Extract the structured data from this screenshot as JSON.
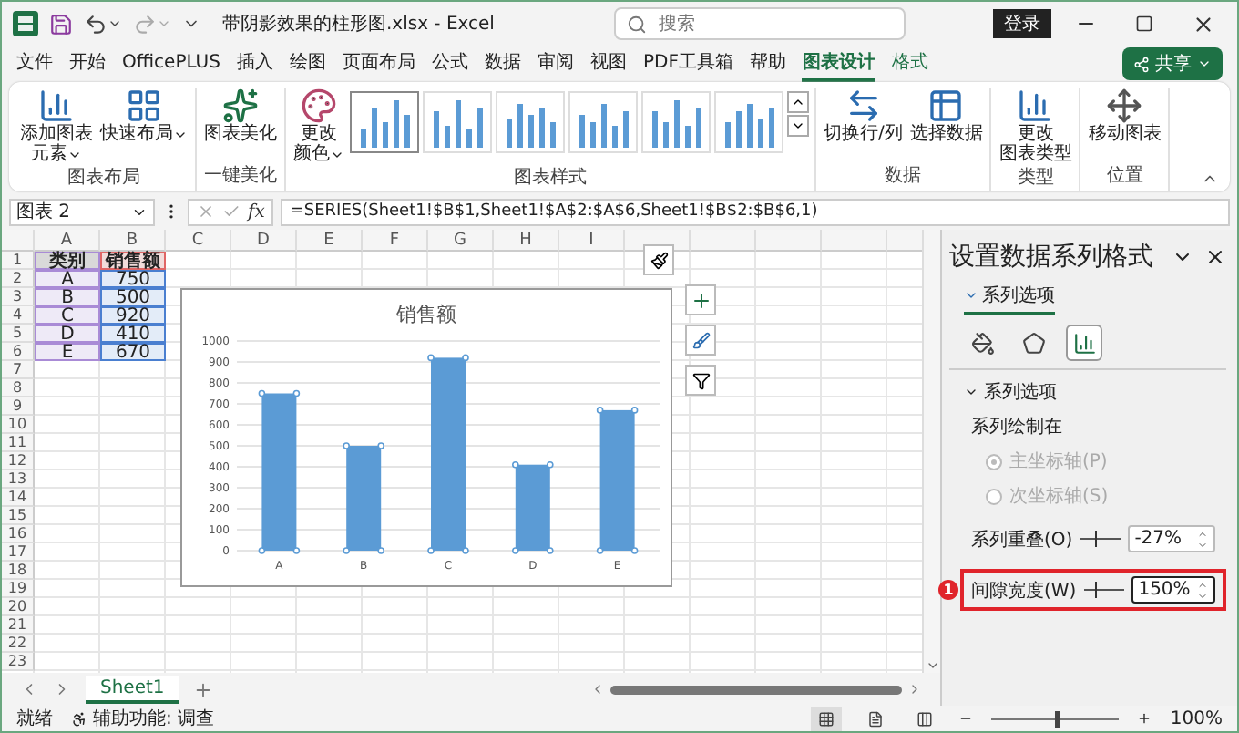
{
  "title_bar": {
    "file_title": "带阴影效果的柱形图.xlsx  -  Excel",
    "search": {
      "placeholder": "搜索"
    },
    "sign_in": "登录"
  },
  "menu_tabs": [
    {
      "label": "文件",
      "selected": false,
      "kind": "normal"
    },
    {
      "label": "开始",
      "selected": false,
      "kind": "normal"
    },
    {
      "label": "OfficePLUS",
      "selected": false,
      "kind": "normal"
    },
    {
      "label": "插入",
      "selected": false,
      "kind": "normal"
    },
    {
      "label": "绘图",
      "selected": false,
      "kind": "normal"
    },
    {
      "label": "页面布局",
      "selected": false,
      "kind": "normal"
    },
    {
      "label": "公式",
      "selected": false,
      "kind": "normal"
    },
    {
      "label": "数据",
      "selected": false,
      "kind": "normal"
    },
    {
      "label": "审阅",
      "selected": false,
      "kind": "normal"
    },
    {
      "label": "视图",
      "selected": false,
      "kind": "normal"
    },
    {
      "label": "PDF工具箱",
      "selected": false,
      "kind": "normal"
    },
    {
      "label": "帮助",
      "selected": false,
      "kind": "normal"
    },
    {
      "label": "图表设计",
      "selected": true,
      "kind": "contextual"
    },
    {
      "label": "格式",
      "selected": false,
      "kind": "contextual"
    }
  ],
  "share_button": "共享",
  "ribbon": {
    "groups": [
      {
        "name": "图表布局",
        "buttons": [
          {
            "lines": [
              "添加图表",
              "元素"
            ],
            "dropdown": true
          },
          {
            "lines": [
              "快速布局"
            ],
            "dropdown": true
          }
        ]
      },
      {
        "name": "一键美化",
        "buttons": [
          {
            "lines": [
              "图表美化"
            ],
            "dropdown": false
          }
        ]
      },
      {
        "name": "图表样式",
        "buttons": [
          {
            "lines": [
              "更改",
              "颜色"
            ],
            "dropdown": true
          }
        ],
        "styles": [
          {
            "selected": true
          },
          {
            "selected": false
          },
          {
            "selected": false
          },
          {
            "selected": false
          },
          {
            "selected": false
          },
          {
            "selected": false
          }
        ]
      },
      {
        "name": "数据",
        "buttons": [
          {
            "lines": [
              "切换行/列"
            ],
            "dropdown": false
          },
          {
            "lines": [
              "选择数据"
            ],
            "dropdown": false
          }
        ]
      },
      {
        "name": "类型",
        "buttons": [
          {
            "lines": [
              "更改",
              "图表类型"
            ],
            "dropdown": false
          }
        ]
      },
      {
        "name": "位置",
        "buttons": [
          {
            "lines": [
              "移动图表"
            ],
            "dropdown": false
          }
        ]
      }
    ]
  },
  "formula_bar": {
    "name_box": "图表 2",
    "fx_label": "fx",
    "formula": "=SERIES(Sheet1!$B$1,Sheet1!$A$2:$A$6,Sheet1!$B$2:$B$6,1)"
  },
  "sheet": {
    "columns": [
      "A",
      "B",
      "C",
      "D",
      "E",
      "F",
      "G",
      "H",
      "I"
    ],
    "row_numbers": [
      "1",
      "2",
      "3",
      "4",
      "5",
      "6",
      "7",
      "8",
      "9",
      "10",
      "11",
      "12",
      "13",
      "14",
      "15",
      "16",
      "17",
      "18",
      "19",
      "20",
      "21",
      "22",
      "23"
    ],
    "cells": [
      [
        "类别",
        "销售额"
      ],
      [
        "A",
        "750"
      ],
      [
        "B",
        "500"
      ],
      [
        "C",
        "920"
      ],
      [
        "D",
        "410"
      ],
      [
        "E",
        "670"
      ]
    ]
  },
  "chart": {
    "chart_data": {
      "type": "bar",
      "title": "销售额",
      "categories": [
        "A",
        "B",
        "C",
        "D",
        "E"
      ],
      "series": [
        {
          "color": "#5b9bd5",
          "values": [
            750,
            500,
            920,
            410,
            670
          ]
        }
      ],
      "grid": true,
      "ylim": [
        0,
        1000
      ],
      "yticks": [
        0,
        100,
        200,
        300,
        400,
        500,
        600,
        700,
        800,
        900,
        1000
      ]
    }
  },
  "format_pane": {
    "title": "设置数据系列格式",
    "section_tab": "系列选项",
    "icon_tabs": [
      {
        "selected": false
      },
      {
        "selected": false
      },
      {
        "selected": true
      }
    ],
    "section": {
      "title": "系列选项",
      "expanded": true,
      "plot_on_label": "系列绘制在",
      "radios": [
        {
          "label": "主坐标轴(P)",
          "selected": true,
          "disabled": true
        },
        {
          "label": "次坐标轴(S)",
          "selected": false,
          "disabled": true
        }
      ],
      "settings": [
        {
          "label": "系列重叠(O)",
          "level": 0.37,
          "value": "-27%",
          "highlighted": false
        },
        {
          "label": "间隙宽度(W)",
          "level": 0.3,
          "value": "150%",
          "highlighted": true,
          "badge": "1"
        }
      ]
    }
  },
  "sheet_tabs": [
    {
      "label": "Sheet1",
      "selected": true
    }
  ],
  "status_bar": {
    "ready": "就绪",
    "accessibility": "辅助功能: 调查",
    "views": [
      {
        "selected": true
      },
      {
        "selected": false
      },
      {
        "selected": false
      }
    ],
    "zoom_slider": {
      "level": 0.5
    },
    "zoom": "100%"
  }
}
